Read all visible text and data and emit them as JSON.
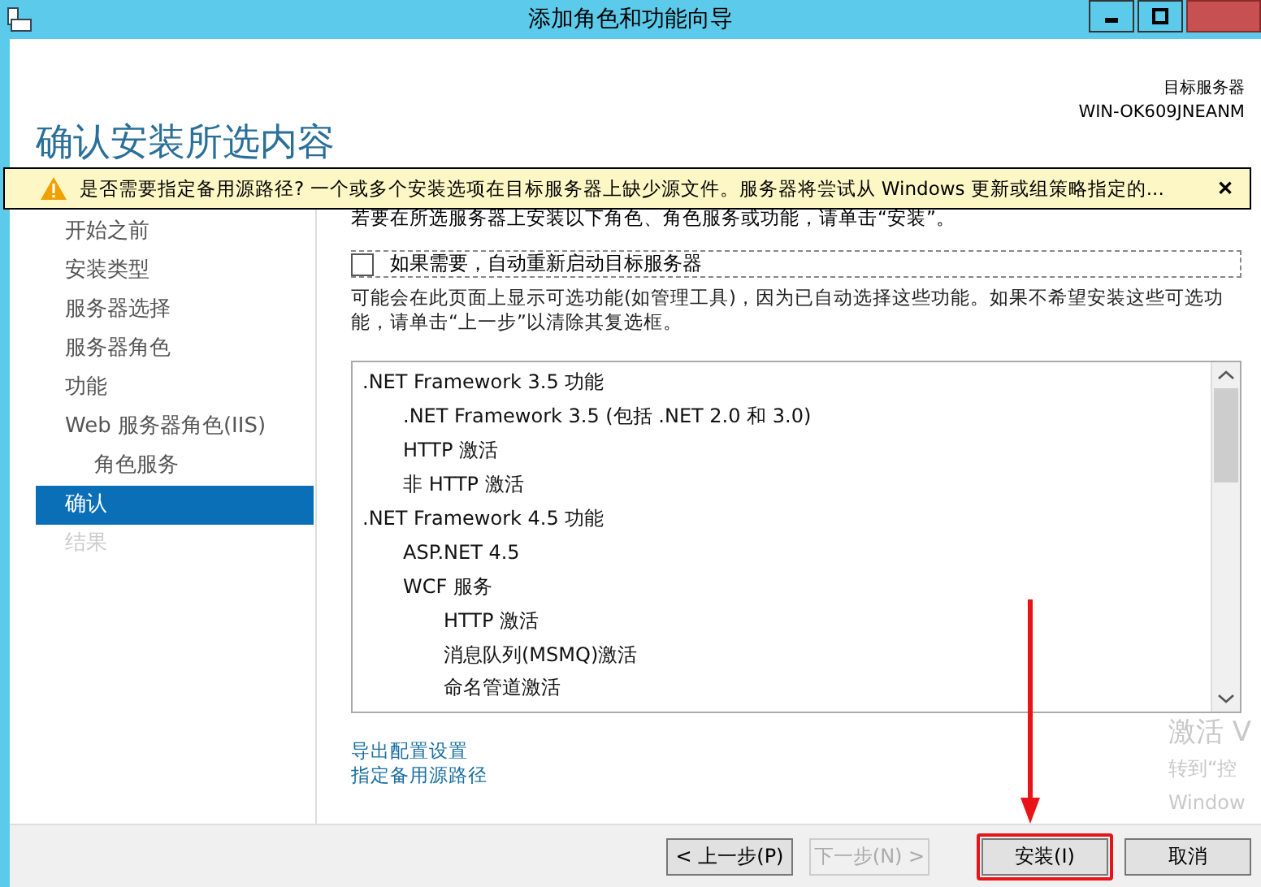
{
  "window": {
    "title": "添加角色和功能向导"
  },
  "header": {
    "title": "确认安装所选内容",
    "server_label": "目标服务器",
    "server_name": "WIN-OK609JNEANM"
  },
  "warning": {
    "text": "是否需要指定备用源路径? 一个或多个安装选项在目标服务器上缺少源文件。服务器将尝试从 Windows 更新或组策略指定的...",
    "close": "✕"
  },
  "sidebar": {
    "items": [
      {
        "label": "开始之前",
        "selected": false,
        "disabled": false
      },
      {
        "label": "安装类型",
        "selected": false,
        "disabled": false
      },
      {
        "label": "服务器选择",
        "selected": false,
        "disabled": false
      },
      {
        "label": "服务器角色",
        "selected": false,
        "disabled": false
      },
      {
        "label": "功能",
        "selected": false,
        "disabled": false
      },
      {
        "label": "Web 服务器角色(IIS)",
        "selected": false,
        "disabled": false,
        "children": [
          {
            "label": "角色服务",
            "selected": false,
            "disabled": false
          }
        ]
      },
      {
        "label": "确认",
        "selected": true,
        "disabled": false
      },
      {
        "label": "结果",
        "selected": false,
        "disabled": true
      }
    ]
  },
  "intro": "若要在所选服务器上安装以下角色、角色服务或功能，请单击“安装”。",
  "restart": {
    "label": "如果需要，自动重新启动目标服务器",
    "checked": false
  },
  "note": "可能会在此页面上显示可选功能(如管理工具)，因为已自动选择这些功能。如果不希望安装这些可选功能，请单击“上一步”以清除其复选框。",
  "features": [
    {
      "label": ".NET Framework 3.5 功能",
      "children": [
        {
          "label": ".NET Framework 3.5 (包括 .NET 2.0 和 3.0)"
        },
        {
          "label": "HTTP 激活"
        },
        {
          "label": "非 HTTP 激活"
        }
      ]
    },
    {
      "label": ".NET Framework 4.5 功能",
      "children": [
        {
          "label": "ASP.NET 4.5"
        },
        {
          "label": "WCF 服务",
          "children": [
            {
              "label": "HTTP 激活"
            },
            {
              "label": "消息队列(MSMQ)激活"
            },
            {
              "label": "命名管道激活"
            }
          ]
        }
      ]
    }
  ],
  "links": [
    "导出配置设置",
    "指定备用源路径"
  ],
  "activation": [
    "激活 V",
    "转到“控",
    "Window"
  ],
  "buttons": [
    {
      "label": "< 上一步(P)",
      "disabled": false,
      "highlighted": false
    },
    {
      "label": "下一步(N) >",
      "disabled": true,
      "highlighted": false
    },
    {
      "label": "安装(I)",
      "disabled": false,
      "highlighted": true
    },
    {
      "label": "取消",
      "disabled": false,
      "highlighted": false
    }
  ]
}
